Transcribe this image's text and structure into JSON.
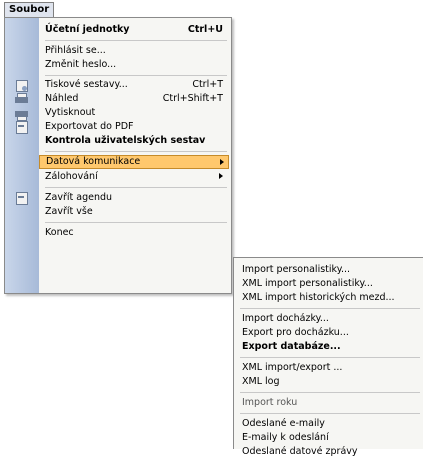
{
  "menubar": {
    "title": "Soubor"
  },
  "menu": {
    "items": [
      {
        "label": "Účetní jednotky",
        "shortcut": "Ctrl+U"
      },
      {
        "label": "Přihlásit se..."
      },
      {
        "label": "Změnit heslo..."
      },
      {
        "label": "Tiskové sestavy...",
        "shortcut": "Ctrl+T"
      },
      {
        "label": "Náhled",
        "shortcut": "Ctrl+Shift+T"
      },
      {
        "label": "Vytisknout"
      },
      {
        "label": "Exportovat do PDF"
      },
      {
        "label": "Kontrola uživatelských sestav"
      },
      {
        "label": "Datová komunikace"
      },
      {
        "label": "Zálohování"
      },
      {
        "label": "Zavřít agendu"
      },
      {
        "label": "Zavřít vše"
      },
      {
        "label": "Konec"
      }
    ]
  },
  "submenu": {
    "items": [
      {
        "label": "Import personalistiky..."
      },
      {
        "label": "XML import personalistiky..."
      },
      {
        "label": "XML import historických mezd..."
      },
      {
        "label": "Import docházky..."
      },
      {
        "label": "Export pro docházku..."
      },
      {
        "label": "Export databáze..."
      },
      {
        "label": "XML import/export ..."
      },
      {
        "label": "XML log"
      },
      {
        "label": "Import roku"
      },
      {
        "label": "Odeslané e-maily"
      },
      {
        "label": "E-maily k odeslání"
      },
      {
        "label": "Odeslané datové zprávy"
      }
    ]
  },
  "colors": {
    "highlight": "#ffc86d",
    "gutter": "#b8c8e0"
  },
  "icons": [
    "print-preview-icon",
    "printer-icon",
    "export-pdf-icon",
    "close-agenda-icon"
  ]
}
